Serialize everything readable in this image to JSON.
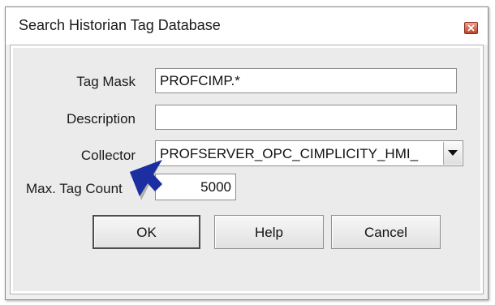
{
  "window": {
    "title": "Search Historian Tag Database",
    "close_icon": "close-x-icon"
  },
  "form": {
    "tag_mask": {
      "label": "Tag Mask",
      "value": "PROFCIMP.*"
    },
    "description": {
      "label": "Description",
      "value": ""
    },
    "collector": {
      "label": "Collector",
      "value": "PROFSERVER_OPC_CIMPLICITY_HMI_"
    },
    "max_tag_count": {
      "label": "Max. Tag Count",
      "value": "5000"
    }
  },
  "buttons": {
    "ok": "OK",
    "help": "Help",
    "cancel": "Cancel"
  },
  "annotation": {
    "icon": "pointer-arrow-icon",
    "color": "#1c2fa0"
  }
}
